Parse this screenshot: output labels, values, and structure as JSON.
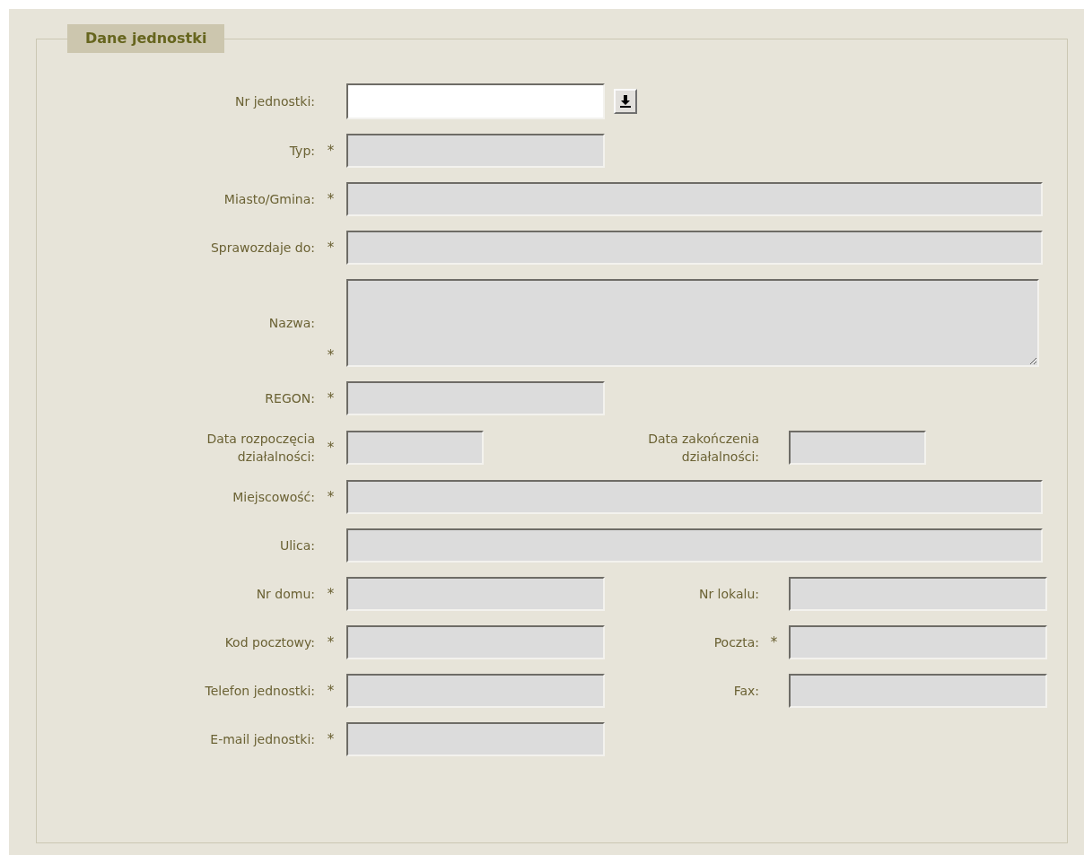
{
  "legend": "Dane jednostki",
  "rows": [
    {
      "kind": "single",
      "fields": [
        {
          "label": "Nr jednostki:",
          "required": false,
          "disabled": false,
          "kind": "short",
          "lookup": true
        }
      ]
    },
    {
      "kind": "single",
      "fields": [
        {
          "label": "Typ:",
          "required": true,
          "disabled": true,
          "kind": "short"
        }
      ]
    },
    {
      "kind": "single",
      "fields": [
        {
          "label": "Miasto/Gmina:",
          "required": true,
          "disabled": true,
          "kind": "long"
        }
      ]
    },
    {
      "kind": "single",
      "fields": [
        {
          "label": "Sprawozdaje do:",
          "required": true,
          "disabled": true,
          "kind": "long"
        }
      ]
    },
    {
      "kind": "single",
      "fields": [
        {
          "label": "Nazwa:",
          "required": true,
          "disabled": true,
          "kind": "area"
        }
      ]
    },
    {
      "kind": "single",
      "fields": [
        {
          "label": "REGON:",
          "required": true,
          "disabled": true,
          "kind": "short"
        }
      ]
    },
    {
      "kind": "pair",
      "fields": [
        {
          "label": "Data rozpoczęcia działalności:",
          "required": true,
          "disabled": true,
          "kind": "date"
        },
        {
          "label": "Data zakończenia działalności:",
          "required": false,
          "disabled": true,
          "kind": "date"
        }
      ]
    },
    {
      "kind": "single",
      "fields": [
        {
          "label": "Miejscowość:",
          "required": true,
          "disabled": true,
          "kind": "long"
        }
      ]
    },
    {
      "kind": "single",
      "fields": [
        {
          "label": "Ulica:",
          "required": false,
          "disabled": true,
          "kind": "long"
        }
      ]
    },
    {
      "kind": "pair",
      "fields": [
        {
          "label": "Nr domu:",
          "required": true,
          "disabled": true,
          "kind": "short"
        },
        {
          "label": "Nr lokalu:",
          "required": false,
          "disabled": true,
          "kind": "short"
        }
      ]
    },
    {
      "kind": "pair",
      "fields": [
        {
          "label": "Kod pocztowy:",
          "required": true,
          "disabled": true,
          "kind": "short"
        },
        {
          "label": "Poczta:",
          "required": true,
          "disabled": true,
          "kind": "short"
        }
      ]
    },
    {
      "kind": "pair",
      "fields": [
        {
          "label": "Telefon jednostki:",
          "required": true,
          "disabled": true,
          "kind": "short"
        },
        {
          "label": "Fax:",
          "required": false,
          "disabled": true,
          "kind": "short"
        }
      ]
    },
    {
      "kind": "single",
      "fields": [
        {
          "label": "E-mail jednostki:",
          "required": true,
          "disabled": true,
          "kind": "short"
        }
      ]
    }
  ],
  "required_mark": "*"
}
